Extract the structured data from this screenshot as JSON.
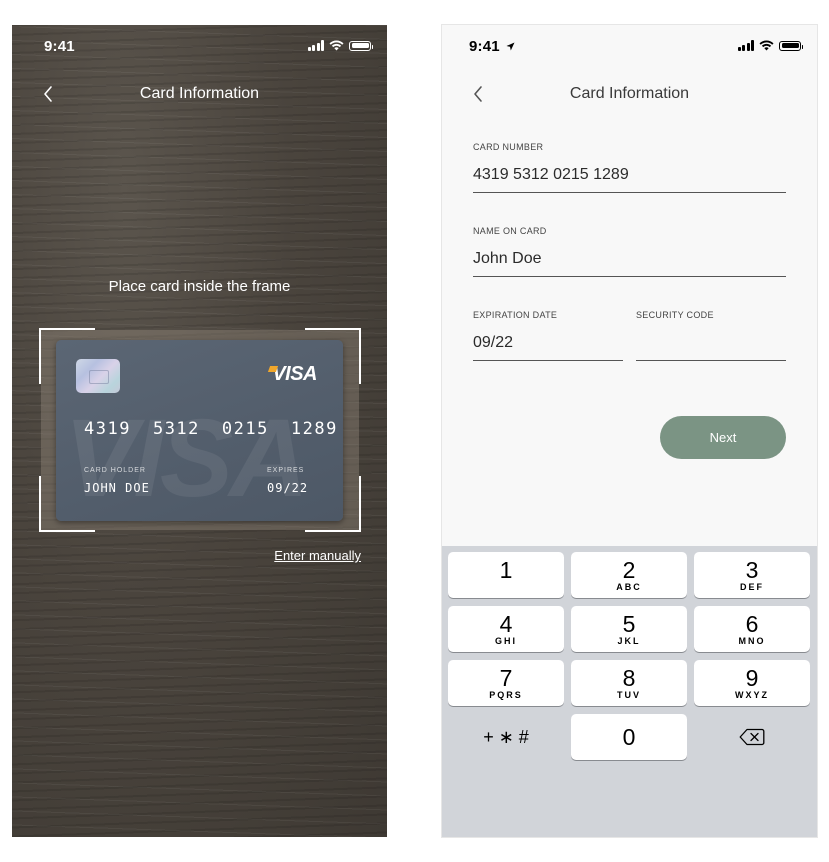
{
  "scan_screen": {
    "status_time": "9:41",
    "title": "Card Information",
    "instruction": "Place card inside the frame",
    "card": {
      "brand": "VISA",
      "number_groups": [
        "4319",
        "5312",
        "0215",
        "1289"
      ],
      "holder_label": "CARD HOLDER",
      "holder_name": "JOHN DOE",
      "expires_label": "EXPIRES",
      "expires_value": "09/22",
      "watermark": "VISA"
    },
    "enter_manually": "Enter manually"
  },
  "form_screen": {
    "status_time": "9:41",
    "title": "Card Information",
    "card_number": {
      "label": "CARD NUMBER",
      "value": "4319 5312 0215 1289"
    },
    "name_on_card": {
      "label": "NAME ON CARD",
      "value": "John Doe"
    },
    "expiration_date": {
      "label": "EXPIRATION DATE",
      "value": "09/22"
    },
    "security_code": {
      "label": "SECURITY CODE",
      "value": ""
    },
    "next_label": "Next",
    "keypad": [
      {
        "digit": "1",
        "letters": ""
      },
      {
        "digit": "2",
        "letters": "ABC"
      },
      {
        "digit": "3",
        "letters": "DEF"
      },
      {
        "digit": "4",
        "letters": "GHI"
      },
      {
        "digit": "5",
        "letters": "JKL"
      },
      {
        "digit": "6",
        "letters": "MNO"
      },
      {
        "digit": "7",
        "letters": "PQRS"
      },
      {
        "digit": "8",
        "letters": "TUV"
      },
      {
        "digit": "9",
        "letters": "WXYZ"
      },
      {
        "digit": "+ ∗ #",
        "letters": ""
      },
      {
        "digit": "0",
        "letters": ""
      }
    ]
  }
}
